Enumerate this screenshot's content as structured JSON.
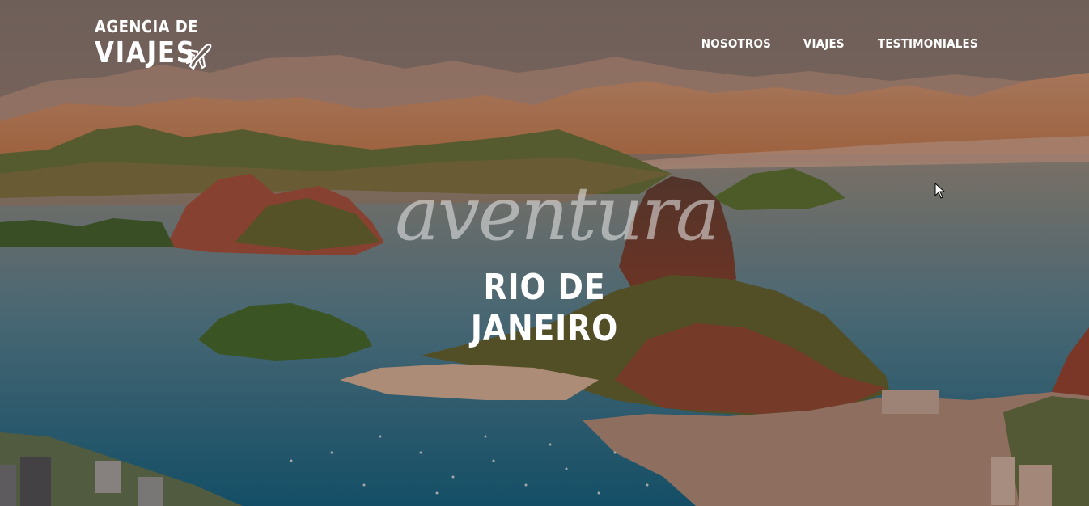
{
  "brand": {
    "logo_line1": "AGENCIA DE",
    "logo_line2": "VIAJES",
    "logo_icon": "airplane-icon"
  },
  "nav": {
    "items": [
      {
        "label": "NOSOTROS"
      },
      {
        "label": "VIAJES"
      },
      {
        "label": "TESTIMONIALES"
      }
    ]
  },
  "hero": {
    "script_text": "aventura",
    "destination": "RIO DE JANEIRO",
    "background": "rio-de-janeiro-bay-photo"
  },
  "colors": {
    "sky": "#8a6f63",
    "mountains": "#b5794e",
    "water": "#1f6d88",
    "vegetation": "#3e5b24",
    "text": "#ffffff"
  }
}
